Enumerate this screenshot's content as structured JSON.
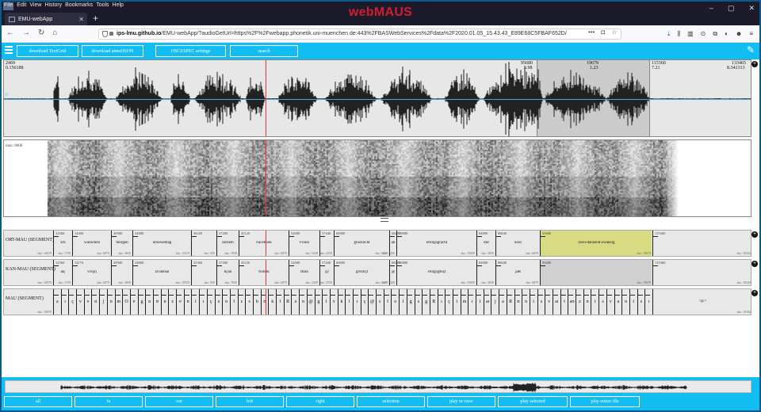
{
  "browser": {
    "menu": [
      "File",
      "Edit",
      "View",
      "History",
      "Bookmarks",
      "Tools",
      "Help"
    ],
    "tab_title": "EMU-webApp",
    "new_tab": "+",
    "window_controls": [
      "–",
      "▢",
      "✕"
    ],
    "url_host": "ips-lmu.github.io",
    "url_rest": "/EMU-webApp/?audioGetUrl=https%2F%2Fwebapp.phonetik.uni-muenchen.de:443%2FBASWebServices%2Fdata%2F2020.01.05_15.43.43_E89E68C5FBAF652D/"
  },
  "app": {
    "title": "webMAUS",
    "toolbar": [
      "download TextGrid",
      "download annotJSON",
      "OSCI/SPEC settings",
      "search"
    ],
    "bottom_buttons": [
      "all",
      "in",
      "out",
      "left",
      "right",
      "selection",
      "play in view",
      "play selected",
      "play entire file"
    ]
  },
  "wave": {
    "left_top": "2469",
    "left_sub": "0.156188",
    "zero_label": "0",
    "sel_start_top": "95680",
    "sel_start_sub": "5.98",
    "sel_mid_top": "19679",
    "sel_mid_sub": "1.23",
    "sel_end_top": "115360",
    "sel_end_sub": "7.21",
    "right_top": "133465",
    "right_sub": "8.341313"
  },
  "spectrogram": {
    "label": "max: 8000"
  },
  "levels": [
    {
      "name": "ORT-MAU (SEGMENT)",
      "first_dur": "dur: 10079",
      "segments": [
        {
          "s": "12560",
          "l": "Ich",
          "d": "dur: 1759"
        },
        {
          "s": "14400",
          "l": "wünschen",
          "d": "dur: 6879"
        },
        {
          "s": "20960",
          "l": "morgen",
          "d": "dur: 3839"
        },
        {
          "s": "24800",
          "l": "unwesentag",
          "d": "dur: 11519"
        },
        {
          "s": "36320",
          "l": "",
          "d": "dur: 959"
        },
        {
          "s": "37280",
          "l": "lächeln",
          "d": "dur: 7839"
        },
        {
          "s": "45120",
          "l": "Facebook",
          "d": "dur: 6879"
        },
        {
          "s": "52000",
          "l": "Fronn",
          "d": "dur: 5439"
        },
        {
          "s": "57440",
          "l": "",
          "d": "dur: 2559"
        },
        {
          "s": "60000",
          "l": "glücklicht",
          "d": "dur: 8279"
        },
        {
          "s": "68280",
          "l": "an",
          "d": "dur: 1200"
        },
        {
          "s": "70880",
          "l": "erfolgsgrächt",
          "d": "dur: 15839"
        },
        {
          "s": "84800",
          "l": "mit",
          "d": "dur: 3839"
        },
        {
          "s": "88640",
          "l": "Sour",
          "d": "dur: 6879"
        },
        {
          "s": "95680",
          "l": "zwei-danzend-zwanzig",
          "d": "dur: 19679"
        },
        {
          "s": "115360",
          "l": "",
          "d": "dur: 18104"
        }
      ]
    },
    {
      "name": "KAN-MAU (SEGMENT)",
      "first_dur": "dur: 10079",
      "segments": [
        {
          "s": "12560",
          "l": "aɪç",
          "d": "dur: 1759"
        },
        {
          "s": "14176",
          "l": "vʏnʃn̩",
          "d": "dur: 6879"
        },
        {
          "s": "20960",
          "l": "",
          "d": "dur: 3839"
        },
        {
          "s": "24800",
          "l": "zɪvəntsaɪ",
          "d": "dur: 10559"
        },
        {
          "s": "35360",
          "l": "",
          "d": "dur: 959"
        },
        {
          "s": "37280",
          "l": "lɪçən",
          "d": "dur: 7839"
        },
        {
          "s": "45120",
          "l": "fɛsbʊk",
          "d": "dur: 6879"
        },
        {
          "s": "52000",
          "l": "fRən",
          "d": "dur: 5439"
        },
        {
          "s": "57440",
          "l": "@",
          "d": "dur: 2559"
        },
        {
          "s": "60000",
          "l": "glʏklɪçt",
          "d": "dur: 8279"
        },
        {
          "s": "68280",
          "l": "@",
          "d": "dur: 1200"
        },
        {
          "s": "70880",
          "l": "ɛfolgsgRɪçt",
          "d": "dur: 15839"
        },
        {
          "s": "84800",
          "l": "",
          "d": "dur: 3839"
        },
        {
          "s": "88640",
          "l": "jaR",
          "d": "dur: 6879"
        },
        {
          "s": "95680",
          "l": "",
          "d": "dur: 19679"
        },
        {
          "s": "115360",
          "l": "",
          "d": "dur: 18104"
        }
      ]
    },
    {
      "name": "MAU (SEGMENT)",
      "first_dur": "dur: 10079",
      "phones": [
        "a",
        "ɪ",
        "ç",
        "v",
        "ʏ",
        "n",
        "ʃ",
        "n",
        "m",
        "O",
        "ɐ",
        "g",
        "n",
        "ʊ",
        "n",
        "z",
        "ɐ",
        "n",
        "l",
        "ɪ",
        "ç",
        "ə",
        "n",
        "f",
        "ɛ",
        "s",
        "b",
        "ʊ",
        "k",
        "f",
        "R",
        "ə",
        "n",
        "@",
        "g",
        "l",
        "ʏ",
        "k",
        "l",
        "ɪ",
        "ç",
        "@",
        "ɛ",
        "f",
        "o",
        "l",
        "g",
        "s",
        "g",
        "R",
        "ɪ",
        "ç",
        "t",
        "m",
        "ɪ",
        "t",
        "aɪ",
        "j",
        "a",
        "R",
        "ʊ",
        "n",
        "t",
        "s",
        "v",
        "aɪ",
        "t",
        "aʊ",
        "z",
        "n",
        "t",
        "s",
        "v",
        "a",
        "n",
        "t",
        "s",
        "ɪ"
      ],
      "last_label": "<p:>",
      "last_dur": "dur: 18104"
    }
  ]
}
